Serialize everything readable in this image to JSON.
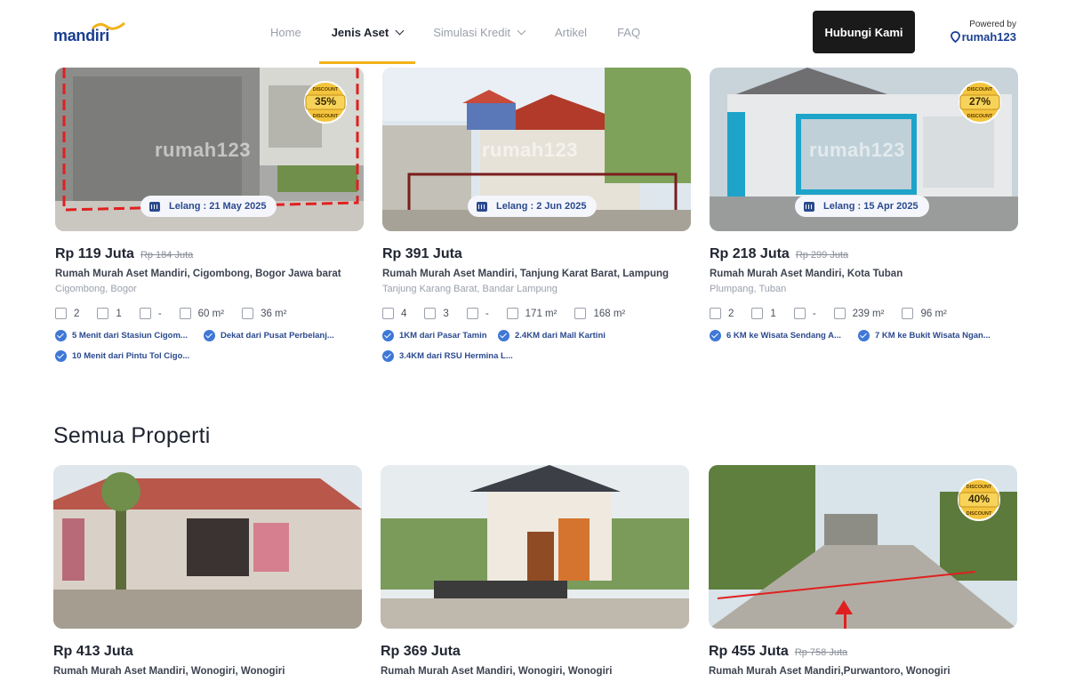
{
  "header": {
    "logo_text": "mandiri",
    "nav": [
      {
        "label": "Home",
        "active": false,
        "dropdown": false
      },
      {
        "label": "Jenis Aset",
        "active": true,
        "dropdown": true
      },
      {
        "label": "Simulasi Kredit",
        "active": false,
        "dropdown": true
      },
      {
        "label": "Artikel",
        "active": false,
        "dropdown": false
      },
      {
        "label": "FAQ",
        "active": false,
        "dropdown": false
      }
    ],
    "contact_button": "Hubungi Kami",
    "powered_label": "Powered by",
    "powered_brand": "rumah123"
  },
  "colors": {
    "accent": "#f2b21a",
    "brand": "#1b3f91",
    "button_dark": "#1a1a1a",
    "check": "#3f78d6"
  },
  "featured": [
    {
      "discount": "35%",
      "lelang": "Lelang : 21 May 2025",
      "price": "Rp 119 Juta",
      "old_price": "Rp 184 Juta",
      "title": "Rumah Murah Aset Mandiri, Cigombong, Bogor Jawa barat",
      "location": "Cigombong, Bogor",
      "specs": {
        "bed": "2",
        "bath": "1",
        "garage": "-",
        "land": "60 m²",
        "building": "36 m²"
      },
      "features": [
        "5 Menit dari Stasiun Cigom...",
        "Dekat dari Pusat Perbelanj...",
        "10 Menit dari Pintu Tol Cigo..."
      ]
    },
    {
      "discount": "",
      "lelang": "Lelang : 2 Jun 2025",
      "price": "Rp 391 Juta",
      "old_price": "",
      "title": "Rumah Murah Aset Mandiri, Tanjung Karat Barat, Lampung",
      "location": "Tanjung Karang Barat, Bandar Lampung",
      "specs": {
        "bed": "4",
        "bath": "3",
        "garage": "-",
        "land": "171 m²",
        "building": "168 m²"
      },
      "features": [
        "1KM dari Pasar Tamin",
        "2.4KM dari Mall Kartini",
        "3.4KM dari RSU Hermina L..."
      ]
    },
    {
      "discount": "27%",
      "lelang": "Lelang : 15 Apr 2025",
      "price": "Rp 218 Juta",
      "old_price": "Rp 299 Juta",
      "title": "Rumah Murah Aset Mandiri, Kota Tuban",
      "location": "Plumpang, Tuban",
      "specs": {
        "bed": "2",
        "bath": "1",
        "garage": "-",
        "land": "239 m²",
        "building": "96 m²"
      },
      "features": [
        "6 KM ke Wisata Sendang A...",
        "7 KM ke Bukit Wisata Ngan..."
      ]
    }
  ],
  "section_title": "Semua Properti",
  "all": [
    {
      "discount": "",
      "price": "Rp 413 Juta",
      "old_price": "",
      "title": "Rumah Murah Aset Mandiri, Wonogiri, Wonogiri"
    },
    {
      "discount": "",
      "price": "Rp 369 Juta",
      "old_price": "",
      "title": "Rumah Murah Aset Mandiri, Wonogiri, Wonogiri"
    },
    {
      "discount": "40%",
      "price": "Rp 455 Juta",
      "old_price": "Rp 758 Juta",
      "title": "Rumah Murah Aset Mandiri,Purwantoro, Wonogiri"
    }
  ],
  "discount_badge_word": "DISCOUNT",
  "watermark": "rumah123"
}
